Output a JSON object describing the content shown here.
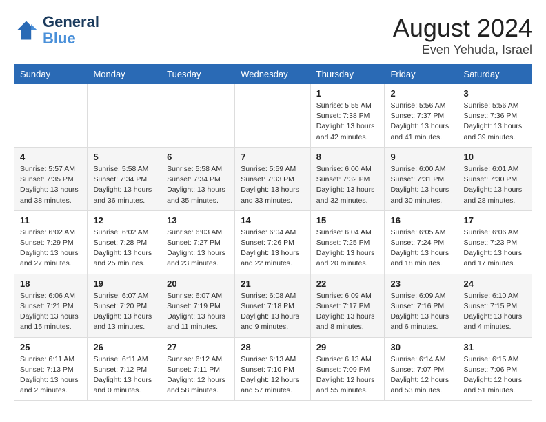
{
  "header": {
    "logo_line1": "General",
    "logo_line2": "Blue",
    "month": "August 2024",
    "location": "Even Yehuda, Israel"
  },
  "weekdays": [
    "Sunday",
    "Monday",
    "Tuesday",
    "Wednesday",
    "Thursday",
    "Friday",
    "Saturday"
  ],
  "weeks": [
    [
      {
        "day": "",
        "info": ""
      },
      {
        "day": "",
        "info": ""
      },
      {
        "day": "",
        "info": ""
      },
      {
        "day": "",
        "info": ""
      },
      {
        "day": "1",
        "info": "Sunrise: 5:55 AM\nSunset: 7:38 PM\nDaylight: 13 hours\nand 42 minutes."
      },
      {
        "day": "2",
        "info": "Sunrise: 5:56 AM\nSunset: 7:37 PM\nDaylight: 13 hours\nand 41 minutes."
      },
      {
        "day": "3",
        "info": "Sunrise: 5:56 AM\nSunset: 7:36 PM\nDaylight: 13 hours\nand 39 minutes."
      }
    ],
    [
      {
        "day": "4",
        "info": "Sunrise: 5:57 AM\nSunset: 7:35 PM\nDaylight: 13 hours\nand 38 minutes."
      },
      {
        "day": "5",
        "info": "Sunrise: 5:58 AM\nSunset: 7:34 PM\nDaylight: 13 hours\nand 36 minutes."
      },
      {
        "day": "6",
        "info": "Sunrise: 5:58 AM\nSunset: 7:34 PM\nDaylight: 13 hours\nand 35 minutes."
      },
      {
        "day": "7",
        "info": "Sunrise: 5:59 AM\nSunset: 7:33 PM\nDaylight: 13 hours\nand 33 minutes."
      },
      {
        "day": "8",
        "info": "Sunrise: 6:00 AM\nSunset: 7:32 PM\nDaylight: 13 hours\nand 32 minutes."
      },
      {
        "day": "9",
        "info": "Sunrise: 6:00 AM\nSunset: 7:31 PM\nDaylight: 13 hours\nand 30 minutes."
      },
      {
        "day": "10",
        "info": "Sunrise: 6:01 AM\nSunset: 7:30 PM\nDaylight: 13 hours\nand 28 minutes."
      }
    ],
    [
      {
        "day": "11",
        "info": "Sunrise: 6:02 AM\nSunset: 7:29 PM\nDaylight: 13 hours\nand 27 minutes."
      },
      {
        "day": "12",
        "info": "Sunrise: 6:02 AM\nSunset: 7:28 PM\nDaylight: 13 hours\nand 25 minutes."
      },
      {
        "day": "13",
        "info": "Sunrise: 6:03 AM\nSunset: 7:27 PM\nDaylight: 13 hours\nand 23 minutes."
      },
      {
        "day": "14",
        "info": "Sunrise: 6:04 AM\nSunset: 7:26 PM\nDaylight: 13 hours\nand 22 minutes."
      },
      {
        "day": "15",
        "info": "Sunrise: 6:04 AM\nSunset: 7:25 PM\nDaylight: 13 hours\nand 20 minutes."
      },
      {
        "day": "16",
        "info": "Sunrise: 6:05 AM\nSunset: 7:24 PM\nDaylight: 13 hours\nand 18 minutes."
      },
      {
        "day": "17",
        "info": "Sunrise: 6:06 AM\nSunset: 7:23 PM\nDaylight: 13 hours\nand 17 minutes."
      }
    ],
    [
      {
        "day": "18",
        "info": "Sunrise: 6:06 AM\nSunset: 7:21 PM\nDaylight: 13 hours\nand 15 minutes."
      },
      {
        "day": "19",
        "info": "Sunrise: 6:07 AM\nSunset: 7:20 PM\nDaylight: 13 hours\nand 13 minutes."
      },
      {
        "day": "20",
        "info": "Sunrise: 6:07 AM\nSunset: 7:19 PM\nDaylight: 13 hours\nand 11 minutes."
      },
      {
        "day": "21",
        "info": "Sunrise: 6:08 AM\nSunset: 7:18 PM\nDaylight: 13 hours\nand 9 minutes."
      },
      {
        "day": "22",
        "info": "Sunrise: 6:09 AM\nSunset: 7:17 PM\nDaylight: 13 hours\nand 8 minutes."
      },
      {
        "day": "23",
        "info": "Sunrise: 6:09 AM\nSunset: 7:16 PM\nDaylight: 13 hours\nand 6 minutes."
      },
      {
        "day": "24",
        "info": "Sunrise: 6:10 AM\nSunset: 7:15 PM\nDaylight: 13 hours\nand 4 minutes."
      }
    ],
    [
      {
        "day": "25",
        "info": "Sunrise: 6:11 AM\nSunset: 7:13 PM\nDaylight: 13 hours\nand 2 minutes."
      },
      {
        "day": "26",
        "info": "Sunrise: 6:11 AM\nSunset: 7:12 PM\nDaylight: 13 hours\nand 0 minutes."
      },
      {
        "day": "27",
        "info": "Sunrise: 6:12 AM\nSunset: 7:11 PM\nDaylight: 12 hours\nand 58 minutes."
      },
      {
        "day": "28",
        "info": "Sunrise: 6:13 AM\nSunset: 7:10 PM\nDaylight: 12 hours\nand 57 minutes."
      },
      {
        "day": "29",
        "info": "Sunrise: 6:13 AM\nSunset: 7:09 PM\nDaylight: 12 hours\nand 55 minutes."
      },
      {
        "day": "30",
        "info": "Sunrise: 6:14 AM\nSunset: 7:07 PM\nDaylight: 12 hours\nand 53 minutes."
      },
      {
        "day": "31",
        "info": "Sunrise: 6:15 AM\nSunset: 7:06 PM\nDaylight: 12 hours\nand 51 minutes."
      }
    ]
  ]
}
